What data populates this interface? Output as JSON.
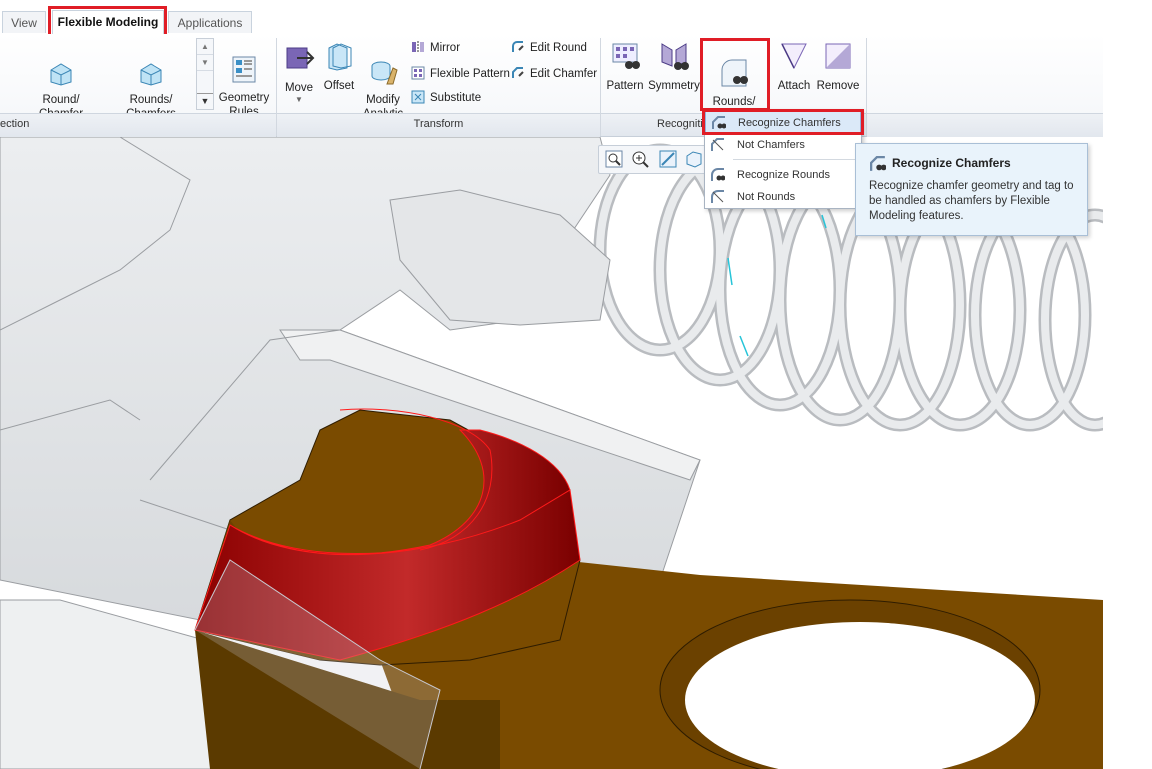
{
  "tabs": [
    {
      "label": "View"
    },
    {
      "label": "Flexible Modeling"
    },
    {
      "label": "Applications"
    }
  ],
  "ribbon": {
    "round_chamfer": "Round/\nChamfer",
    "rounds_chamfers_shape": "Rounds/\nChamfers",
    "geometry_rules": "Geometry\nRules",
    "move": "Move",
    "offset": "Offset",
    "modify_analytic": "Modify\nAnalytic",
    "mirror": "Mirror",
    "flexible_pattern": "Flexible Pattern",
    "substitute": "Substitute",
    "edit_round": "Edit Round",
    "edit_chamfer": "Edit Chamfer",
    "pattern": "Pattern",
    "symmetry": "Symmetry",
    "rounds_chamfers_recognize": "Rounds/\nChamfers",
    "attach": "Attach",
    "remove": "Remove"
  },
  "groups": {
    "selection": "ection",
    "transform": "Transform",
    "recognition": "Recogniti"
  },
  "menu": {
    "items": [
      {
        "label": "Recognize Chamfers"
      },
      {
        "label": "Not Chamfers"
      },
      {
        "label": "Recognize Rounds"
      },
      {
        "label": "Not Rounds"
      }
    ]
  },
  "tooltip": {
    "title": "Recognize Chamfers",
    "body": "Recognize chamfer geometry and tag to be handled as chamfers by Flexible Modeling features."
  },
  "colors": {
    "highlight": "#e01d26",
    "model_gray": "#e8e9eb",
    "part_brown": "#7a4b00",
    "selection_red": "#b00000"
  }
}
